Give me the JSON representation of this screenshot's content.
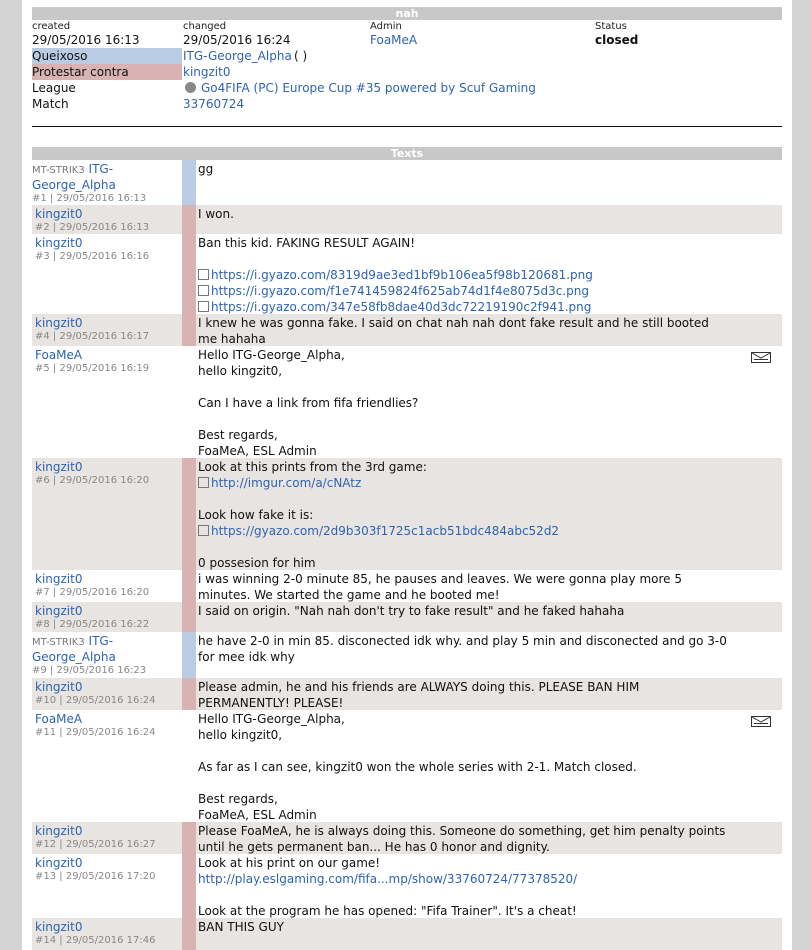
{
  "header": {
    "title": "nah"
  },
  "info": {
    "created_label": "created",
    "created_value": "29/05/2016 16:13",
    "changed_label": "changed",
    "changed_value": "29/05/2016 16:24",
    "admin_label": "Admin",
    "admin_value": "FoaMeA",
    "status_label": "Status",
    "status_value": "closed",
    "complainant_label": "Queixoso",
    "complainant_value": "ITG-George_Alpha",
    "complainant_suffix": "( )",
    "protest_label": "Protestar contra",
    "protest_value": "kingzit0",
    "league_label": "League",
    "league_value": "Go4FIFA (PC) Europe Cup #35 powered by Scuf Gaming",
    "match_label": "Match",
    "match_value": "33760724"
  },
  "texts": {
    "title": "Texts",
    "messages": [
      {
        "team": "MT-STRIK3",
        "name": "ITG-",
        "name2": "George_Alpha",
        "meta": "#1 | 29/05/2016 16:13",
        "side": "blue",
        "shade": false,
        "lines": [
          "gg"
        ]
      },
      {
        "team": "",
        "name": "kingzit0",
        "name2": "",
        "meta": "#2 | 29/05/2016 16:13",
        "side": "red",
        "shade": true,
        "lines": [
          "I won."
        ]
      },
      {
        "team": "",
        "name": "kingzit0",
        "name2": "",
        "meta": "#3 | 29/05/2016 16:16",
        "side": "red",
        "shade": false,
        "lines": [
          "Ban this kid. FAKING RESULT AGAIN!",
          "",
          "https://i.gyazo.com/8319d9ae3ed1bf9b106ea5f98b120681.png",
          "https://i.gyazo.com/f1e741459824f625ab74d1f4e8075d3c.png",
          "https://i.gyazo.com/347e58fb8dae40d3dc72219190c2f941.png"
        ]
      },
      {
        "team": "",
        "name": "kingzit0",
        "name2": "",
        "meta": "#4 | 29/05/2016 16:17",
        "side": "red",
        "shade": true,
        "lines": [
          "I knew he was gonna fake. I said on chat nah nah dont fake result and he still booted",
          "me hahaha"
        ]
      },
      {
        "team": "",
        "name": "FoaMeA",
        "name2": "",
        "meta": "#5 | 29/05/2016 16:19",
        "side": "none",
        "shade": false,
        "mail": true,
        "lines": [
          "Hello ITG-George_Alpha,",
          "hello kingzit0,",
          "",
          "Can I have a link from fifa friendlies?",
          "",
          "Best regards,",
          "FoaMeA, ESL Admin"
        ]
      },
      {
        "team": "",
        "name": "kingzit0",
        "name2": "",
        "meta": "#6 | 29/05/2016 16:20",
        "side": "red",
        "shade": true,
        "lines": [
          "Look at this prints from the 3rd game:",
          "http://imgur.com/a/cNAtz",
          "",
          "Look how fake it is:",
          "https://gyazo.com/2d9b303f1725c1acb51bdc484abc52d2",
          "",
          "0 possesion for him"
        ]
      },
      {
        "team": "",
        "name": "kingzit0",
        "name2": "",
        "meta": "#7 | 29/05/2016 16:20",
        "side": "red",
        "shade": false,
        "lines": [
          "i was winning 2-0 minute 85, he pauses and leaves. We were gonna play more 5",
          "minutes. We started the game and he booted me!"
        ]
      },
      {
        "team": "",
        "name": "kingzit0",
        "name2": "",
        "meta": "#8 | 29/05/2016 16:22",
        "side": "red",
        "shade": true,
        "lines": [
          "I said on origin. \"Nah nah don't try to fake result\" and he faked hahaha"
        ]
      },
      {
        "team": "MT-STRIK3",
        "name": "ITG-",
        "name2": "George_Alpha",
        "meta": "#9 | 29/05/2016 16:23",
        "side": "blue",
        "shade": false,
        "lines": [
          "he have 2-0 in min 85. disconected idk why. and play 5 min and disconected and go 3-0",
          "for mee idk why"
        ]
      },
      {
        "team": "",
        "name": "kingzit0",
        "name2": "",
        "meta": "#10 | 29/05/2016 16:24",
        "side": "red",
        "shade": true,
        "lines": [
          "Please admin, he and his friends are ALWAYS doing this. PLEASE BAN HIM",
          "PERMANENTLY! PLEASE!"
        ]
      },
      {
        "team": "",
        "name": "FoaMeA",
        "name2": "",
        "meta": "#11 | 29/05/2016 16:24",
        "side": "none",
        "shade": false,
        "mail": true,
        "lines": [
          "Hello ITG-George_Alpha,",
          "hello kingzit0,",
          "",
          "As far as I can see, kingzit0 won the whole series with 2-1. Match closed.",
          "",
          "Best regards,",
          "FoaMeA, ESL Admin"
        ]
      },
      {
        "team": "",
        "name": "kingzit0",
        "name2": "",
        "meta": "#12 | 29/05/2016 16:27",
        "side": "red",
        "shade": true,
        "lines": [
          "Please FoaMeA, he is always doing this. Someone do something, get him penalty points",
          "until he gets permanent ban... He has 0 honor and dignity."
        ]
      },
      {
        "team": "",
        "name": "kingzit0",
        "name2": "",
        "meta": "#13 | 29/05/2016 17:20",
        "side": "red",
        "shade": false,
        "lines": [
          "Look at his print on our game!",
          "http://play.eslgaming.com/fifa...mp/show/33760724/77378520/",
          "",
          "Look at the program he has opened: \"Fifa Trainer\". It's a cheat!"
        ]
      },
      {
        "team": "",
        "name": "kingzit0",
        "name2": "",
        "meta": "#14 | 29/05/2016 17:46",
        "side": "red",
        "shade": true,
        "lines": [
          "BAN THIS GUY"
        ]
      }
    ]
  },
  "colors": {
    "link": "#2f63b0",
    "blue_stripe": "#b9cce4",
    "red_stripe": "#d9b3b3",
    "shade": "#e7e4e1"
  },
  "icons": {
    "mail": "envelope-icon",
    "external": "external-link-icon",
    "league": "soccer-ball-icon"
  }
}
